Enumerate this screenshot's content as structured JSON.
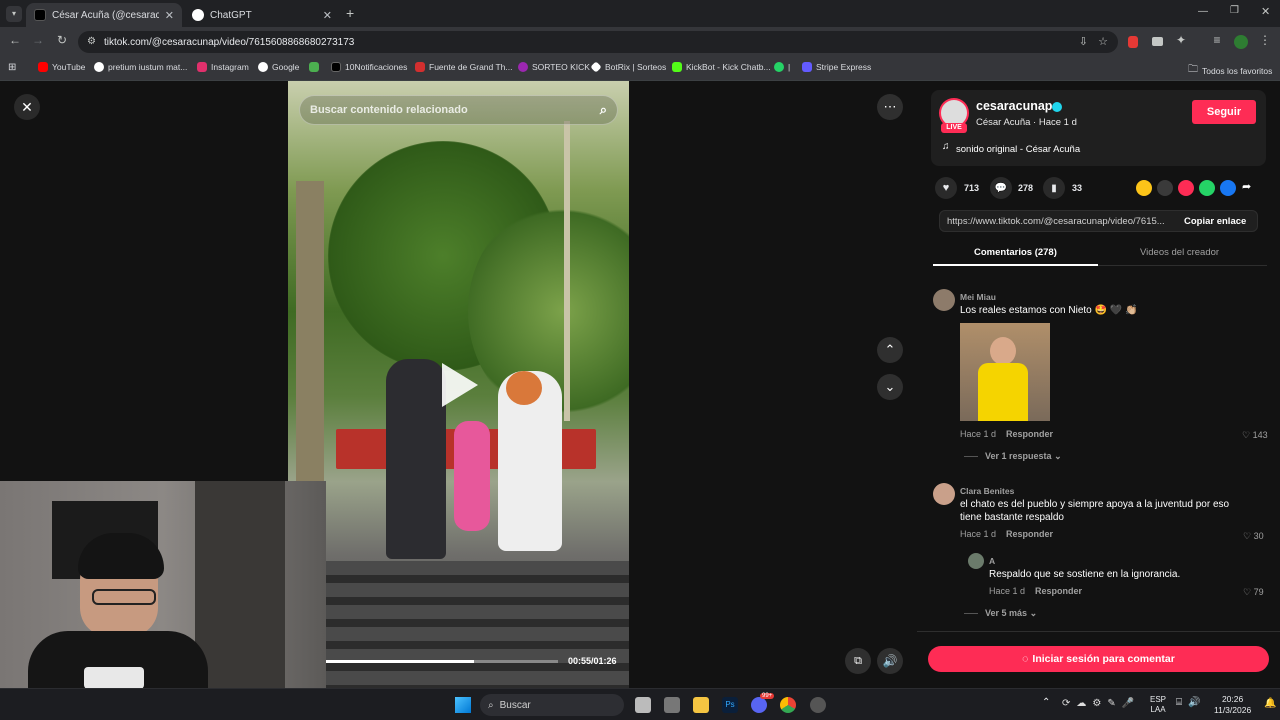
{
  "browser": {
    "tabs": [
      {
        "title": "César Acuña (@cesaracunap) | T",
        "active": true
      },
      {
        "title": "ChatGPT",
        "active": false
      }
    ],
    "new_tab": "+",
    "url": "tiktok.com/@cesaracunap/video/7615608868680273173",
    "bookmarks": [
      "YouTube",
      "pretium iustum mat...",
      "Instagram",
      "Google",
      "10Notificaciones",
      "Fuente de Grand Th...",
      "SORTEO KICK",
      "BotRix | Sorteos",
      "KickBot - Kick Chatb...",
      "|",
      "Stripe Express"
    ],
    "all_bookmarks": "Todos los favoritos"
  },
  "video": {
    "search_placeholder": "Buscar contenido relacionado",
    "time": "00:55/01:26",
    "progress": 0.64
  },
  "panel": {
    "username": "cesaracunap",
    "subtitle": "César Acuña · Hace 1 d",
    "live_badge": "LIVE",
    "follow": "Seguir",
    "sound": "sonido original - César Acuña",
    "likes": "713",
    "comments_count": "278",
    "saves": "33",
    "link": "https://www.tiktok.com/@cesaracunap/video/7615...",
    "copy_link": "Copiar enlace",
    "tab_comments": "Comentarios (278)",
    "tab_videos": "Videos del creador",
    "login_comment": "Iniciar sesión para comentar"
  },
  "comments": [
    {
      "name": "Mei Miau",
      "text": "Los reales estamos con Nieto 🤩 🖤 👏🏼",
      "time": "Hace 1 d",
      "reply": "Responder",
      "likes": "143",
      "more": "Ver 1 respuesta"
    },
    {
      "name": "Clara Benites",
      "text": "el chato es del pueblo y siempre apoya a la juventud por eso tiene bastante respaldo",
      "time": "Hace 1 d",
      "reply": "Responder",
      "likes": "30"
    },
    {
      "name": "A",
      "text": "Respaldo que se sostiene en la ignorancia.",
      "time": "Hace 1 d",
      "reply": "Responder",
      "likes": "79",
      "more": "Ver 5 más"
    }
  ],
  "taskbar": {
    "search": "Buscar",
    "lang_top": "ESP",
    "lang_bottom": "LAA",
    "time": "20:26",
    "date": "11/3/2026",
    "badge": "99+"
  },
  "colors": {
    "accent": "#fe2c55",
    "bg": "#121212",
    "verified": "#20d5ec"
  }
}
